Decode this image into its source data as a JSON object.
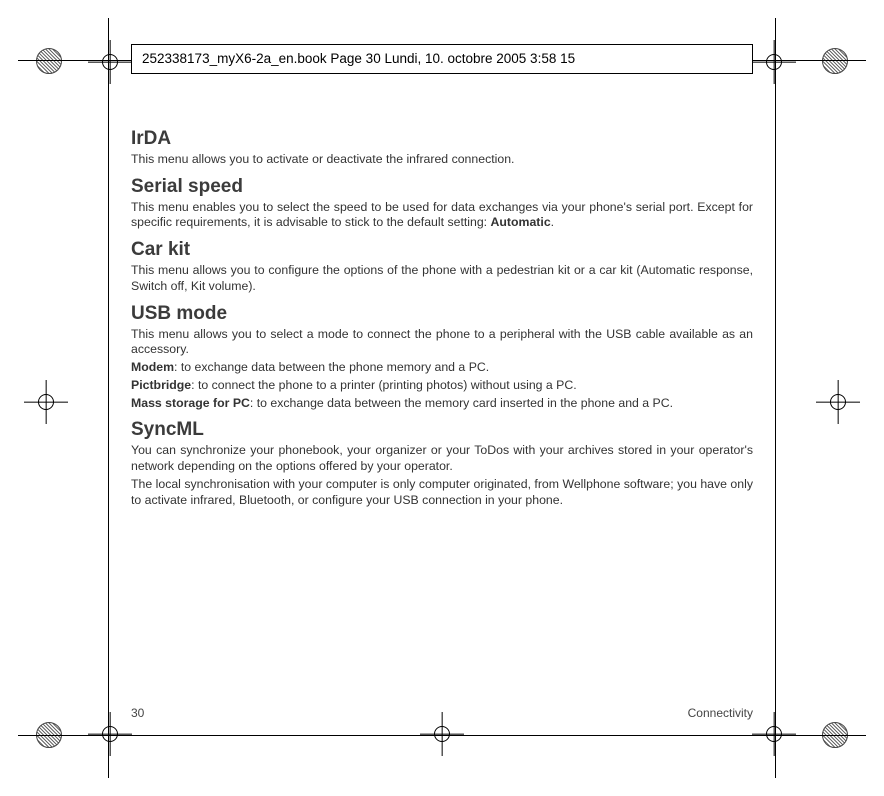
{
  "header": {
    "text": "252338173_myX6-2a_en.book  Page 30  Lundi, 10. octobre 2005  3:58 15"
  },
  "sections": {
    "irda": {
      "title": "IrDA",
      "p1": "This menu allows you to activate or deactivate the infrared connection."
    },
    "serial": {
      "title": "Serial speed",
      "p1_a": "This menu enables you to select the speed to be used for data exchanges via your phone's serial port. Except for specific requirements, it is advisable to stick to the default setting: ",
      "p1_b": "Automatic",
      "p1_c": "."
    },
    "carkit": {
      "title": "Car kit",
      "p1": "This menu allows you to configure the options of the phone with a pedestrian kit or a car kit (Automatic response, Switch off, Kit volume)."
    },
    "usb": {
      "title": "USB mode",
      "p1": "This menu allows you to select a mode to connect the phone to a peripheral with the USB cable available as an accessory.",
      "m_l": "Modem",
      "m_t": ": to exchange data between the phone memory and a PC.",
      "pb_l": "Pictbridge",
      "pb_t": ": to connect the phone to a printer (printing photos) without using a PC.",
      "ms_l": "Mass storage for PC",
      "ms_t": ": to exchange data between the memory card inserted in the phone and a PC."
    },
    "sync": {
      "title": "SyncML",
      "p1": "You can synchronize your phonebook, your organizer or your ToDos with your archives stored in your operator's network depending on the options offered by your operator.",
      "p2": "The local synchronisation with your computer is only computer originated, from Wellphone software; you have only to activate infrared, Bluetooth, or configure your USB connection in your phone."
    }
  },
  "footer": {
    "page": "30",
    "section": "Connectivity"
  }
}
